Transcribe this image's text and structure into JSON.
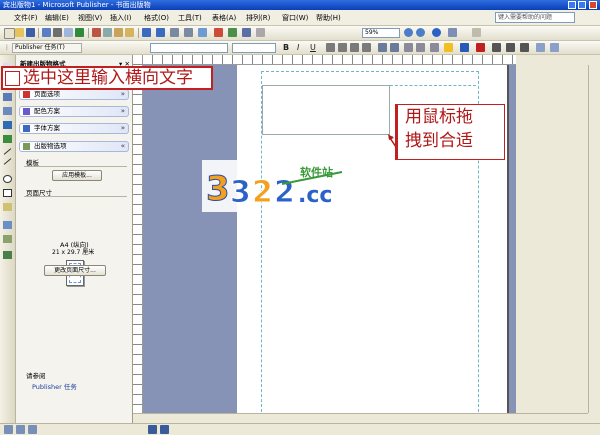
{
  "window": {
    "title": "宾出版物1 - Microsoft Publisher - 书面出版物"
  },
  "menu": {
    "items": [
      "文件(F)",
      "编辑(E)",
      "视图(V)",
      "插入(I)",
      "格式(O)",
      "工具(T)",
      "表格(A)",
      "排列(R)",
      "窗口(W)",
      "帮助(H)"
    ],
    "help_placeholder": "键入需要帮助的问题"
  },
  "toolbar": {
    "zoom": "59%",
    "publisher_tasks_label": "Publisher 任务(T)"
  },
  "format_bar": {
    "bold": "B",
    "italic": "I",
    "underline": "U"
  },
  "task_pane": {
    "title": "新建出版物格式",
    "sections": [
      "页面选项",
      "配色方案",
      "字体方案",
      "出版物选项"
    ],
    "template_label": "模板",
    "apply_template_button": "应用模板...",
    "page_size_label": "页面尺寸",
    "page_name": "A4 (纵向)",
    "page_dims": "21 x 29.7 厘米",
    "change_size_button": "更改页面尺寸...",
    "see_also_label": "请参阅",
    "see_also_link": "Publisher 任务"
  },
  "annotations": {
    "left_callout": "选中这里输入横向文字",
    "right_callout_line1": "用鼠标拖",
    "right_callout_line2": "拽到合适"
  },
  "watermark": {
    "number_text": "3322",
    "suffix": ".cc",
    "tagline": "软件站"
  },
  "colors": {
    "annotation_red": "#b01818",
    "workspace": "#8693b7",
    "title_blue": "#0a3fb8"
  }
}
